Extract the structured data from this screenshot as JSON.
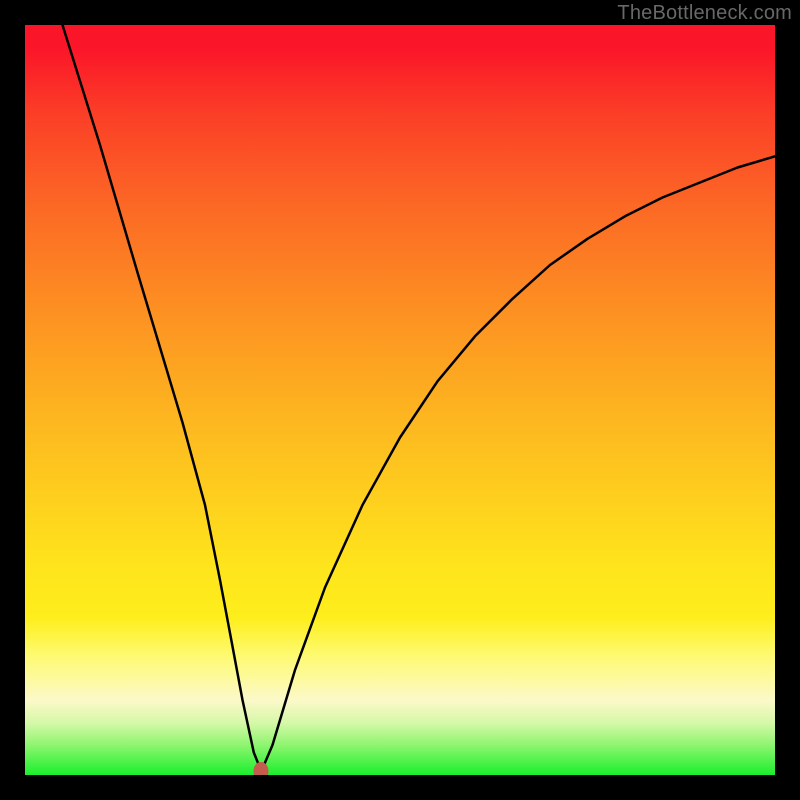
{
  "watermark": "TheBottleneck.com",
  "colors": {
    "curve": "#000000",
    "marker": "#c45d4e",
    "background_top": "#fb1529",
    "background_bottom": "#1aef2c",
    "font": "#676966"
  },
  "chart_data": {
    "type": "line",
    "title": "",
    "xlabel": "",
    "ylabel": "",
    "xlim": [
      0,
      100
    ],
    "ylim": [
      0,
      100
    ],
    "grid": false,
    "series": [
      {
        "name": "bottleneck-curve",
        "x": [
          5,
          10,
          15,
          18,
          21,
          24,
          26,
          27.5,
          29,
          30.5,
          31.5,
          33,
          36,
          40,
          45,
          50,
          55,
          60,
          65,
          70,
          75,
          80,
          85,
          90,
          95,
          100
        ],
        "values": [
          100,
          84,
          67,
          57,
          47,
          36,
          26,
          18,
          10,
          3,
          0.5,
          4,
          14,
          25,
          36,
          45,
          52.5,
          58.5,
          63.5,
          68,
          71.5,
          74.5,
          77,
          79,
          81,
          82.5
        ]
      }
    ],
    "marker": {
      "x": 31.5,
      "y": 0.5
    },
    "gradient_stops": [
      {
        "pos": 0,
        "color": "#fb1529"
      },
      {
        "pos": 12,
        "color": "#fb3f27"
      },
      {
        "pos": 25,
        "color": "#fc6b25"
      },
      {
        "pos": 38,
        "color": "#fd9022"
      },
      {
        "pos": 52,
        "color": "#fdb520"
      },
      {
        "pos": 72,
        "color": "#fee41c"
      },
      {
        "pos": 84,
        "color": "#fefa70"
      },
      {
        "pos": 93,
        "color": "#d6f8a9"
      },
      {
        "pos": 100,
        "color": "#1aef2c"
      }
    ]
  }
}
